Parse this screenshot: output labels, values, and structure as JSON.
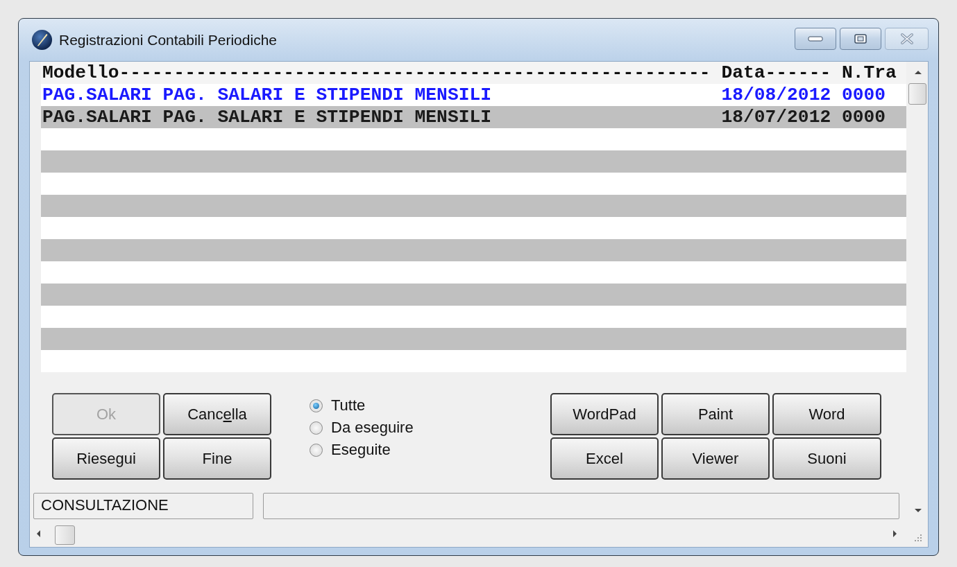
{
  "window": {
    "title": "Registrazioni Contabili Periodiche"
  },
  "list": {
    "columns": [
      "Modello------------------------------------------------------",
      "Data------",
      "N.Tra"
    ],
    "rows": [
      {
        "cells": [
          "PAG.SALARI PAG. SALARI E STIPENDI MENSILI",
          "18/08/2012",
          "0000"
        ],
        "selected": true
      },
      {
        "cells": [
          "PAG.SALARI PAG. SALARI E STIPENDI MENSILI",
          "18/07/2012",
          "0000"
        ],
        "selected": false
      }
    ]
  },
  "action_buttons": [
    {
      "label_parts": [
        "Ok"
      ],
      "disabled": true
    },
    {
      "label_parts": [
        "Canc",
        "e",
        "lla"
      ],
      "disabled": false
    },
    {
      "label_parts": [
        "Riesegui"
      ],
      "disabled": false
    },
    {
      "label_parts": [
        "Fine"
      ],
      "disabled": false
    }
  ],
  "filter": [
    {
      "label": "Tutte",
      "selected": true
    },
    {
      "label": "Da eseguire",
      "selected": false
    },
    {
      "label": "Eseguite",
      "selected": false
    }
  ],
  "app_buttons": [
    "WordPad",
    "Paint",
    "Word",
    "Excel",
    "Viewer",
    "Suoni"
  ],
  "status_bar": {
    "mode": "CONSULTAZIONE"
  }
}
